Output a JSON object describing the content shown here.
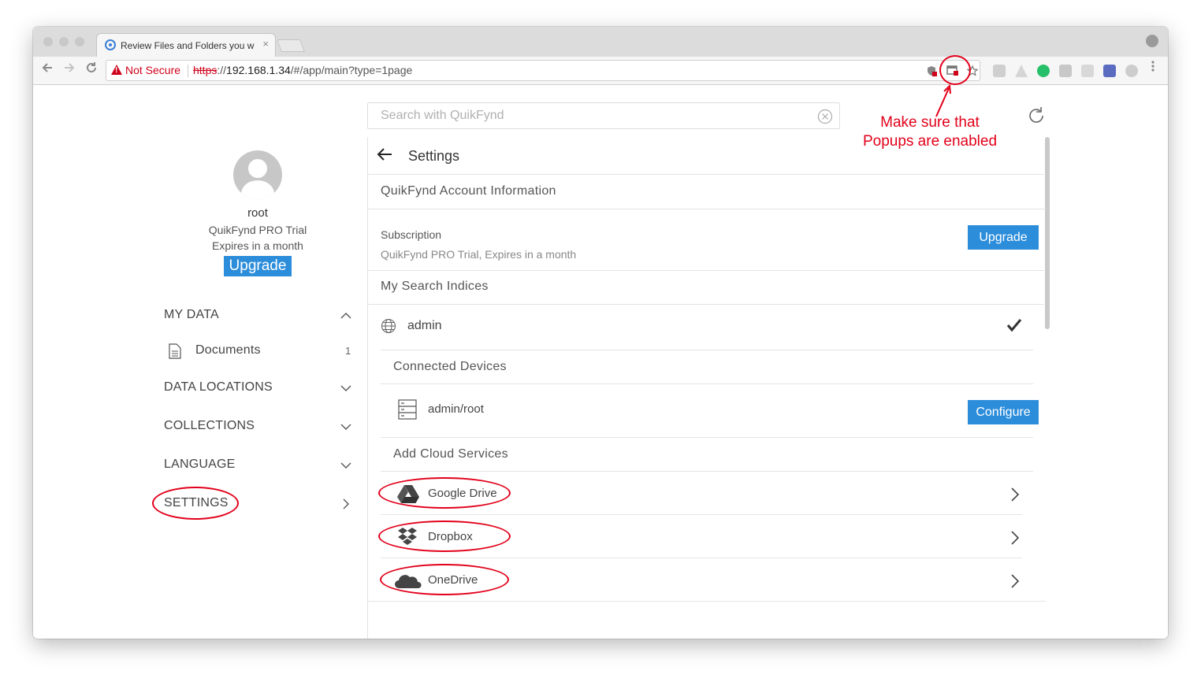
{
  "browser": {
    "tab_title": "Review Files and Folders you w",
    "tab_close": "×",
    "security_label": "Not Secure",
    "url_scheme": "https",
    "url_sep": "://",
    "url_host": "192.168.1.34",
    "url_path": "/#/app/main?type=1page"
  },
  "sidebar": {
    "user_name": "root",
    "plan": "QuikFynd PRO Trial",
    "expiry": "Expires in a month",
    "upgrade_label": "Upgrade",
    "my_data_label": "MY DATA",
    "documents_label": "Documents",
    "documents_count": "1",
    "data_locations_label": "DATA LOCATIONS",
    "collections_label": "COLLECTIONS",
    "language_label": "LANGUAGE",
    "settings_label": "SETTINGS"
  },
  "search": {
    "placeholder": "Search with QuikFynd"
  },
  "settings": {
    "title": "Settings",
    "account_header": "QuikFynd Account Information",
    "subscription_label": "Subscription",
    "subscription_value": "QuikFynd PRO Trial, Expires in a month",
    "upgrade_label": "Upgrade",
    "indices_header": "My Search Indices",
    "index_name": "admin",
    "devices_header": "Connected Devices",
    "device_name": "admin/root",
    "configure_label": "Configure",
    "cloud_header": "Add Cloud Services",
    "services": [
      {
        "name": "Google Drive"
      },
      {
        "name": "Dropbox"
      },
      {
        "name": "OneDrive"
      }
    ]
  },
  "annotation": {
    "line1": "Make sure that",
    "line2": "Popups are enabled"
  },
  "colors": {
    "accent": "#2c8ddb",
    "annotation": "#e2001a",
    "warning": "#d0021b"
  }
}
